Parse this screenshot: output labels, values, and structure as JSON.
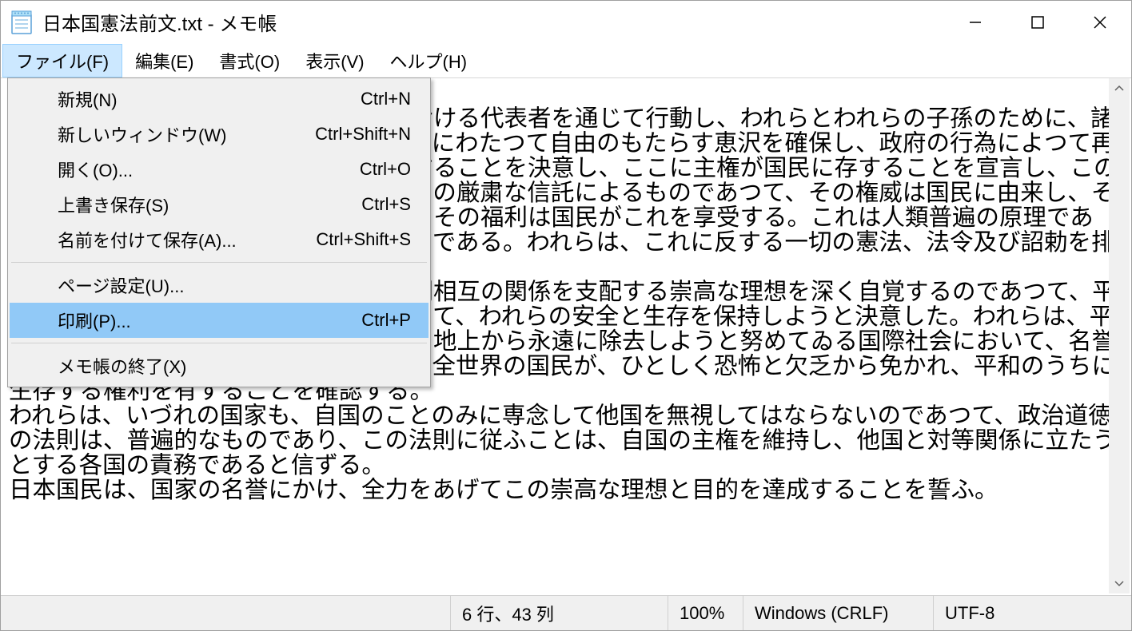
{
  "titlebar": {
    "title": "日本国憲法前文.txt - メモ帳"
  },
  "menubar": {
    "items": [
      {
        "label": "ファイル(F)"
      },
      {
        "label": "編集(E)"
      },
      {
        "label": "書式(O)"
      },
      {
        "label": "表示(V)"
      },
      {
        "label": "ヘルプ(H)"
      }
    ]
  },
  "dropdown": {
    "items": [
      {
        "label": "新規(N)",
        "shortcut": "Ctrl+N"
      },
      {
        "label": "新しいウィンドウ(W)",
        "shortcut": "Ctrl+Shift+N"
      },
      {
        "label": "開く(O)...",
        "shortcut": "Ctrl+O"
      },
      {
        "label": "上書き保存(S)",
        "shortcut": "Ctrl+S"
      },
      {
        "label": "名前を付けて保存(A)...",
        "shortcut": "Ctrl+Shift+S"
      },
      {
        "label": "ページ設定(U)...",
        "shortcut": ""
      },
      {
        "label": "印刷(P)...",
        "shortcut": "Ctrl+P"
      },
      {
        "label": "メモ帳の終了(X)",
        "shortcut": ""
      }
    ]
  },
  "document_text": "\n日本国民は、正当に選挙された国会における代表者を通じて行動し、われらとわれらの子孫のために、諸国民との協和による成果と、わが国全土にわたつて自由のもたらす恵沢を確保し、政府の行為によつて再び戦争の惨禍が起ることのないやうにすることを決意し、ここに主権が国民に存することを宣言し、この憲法を確定する。そもそも国政は、国民の厳粛な信託によるものであつて、その権威は国民に由来し、その権力は国民の代表者がこれを行使し、その福利は国民がこれを享受する。これは人類普遍の原理であり、この憲法は、かかる原理に基くものである。われらは、これに反する一切の憲法、法令及び詔勅を排除する。\n日本国民は、恒久の平和を念願し、人間相互の関係を支配する崇高な理想を深く自覚するのであつて、平和を愛する諸国民の公正と信義に信頼して、われらの安全と生存を保持しようと決意した。われらは、平和を維持し、専制と隷従、圧迫と偏狭を地上から永遠に除去しようと努めてゐる国際社会において、名誉ある地位を占めたいと思ふ。われらは、全世界の国民が、ひとしく恐怖と欠乏から免かれ、平和のうちに生存する権利を有することを確認する。\nわれらは、いづれの国家も、自国のことのみに専念して他国を無視してはならないのであつて、政治道徳の法則は、普遍的なものであり、この法則に従ふことは、自国の主権を維持し、他国と対等関係に立たうとする各国の責務であると信ずる。\n日本国民は、国家の名誉にかけ、全力をあげてこの崇高な理想と目的を達成することを誓ふ。",
  "statusbar": {
    "position": "6 行、43 列",
    "zoom": "100%",
    "eol": "Windows (CRLF)",
    "encoding": "UTF-8"
  }
}
